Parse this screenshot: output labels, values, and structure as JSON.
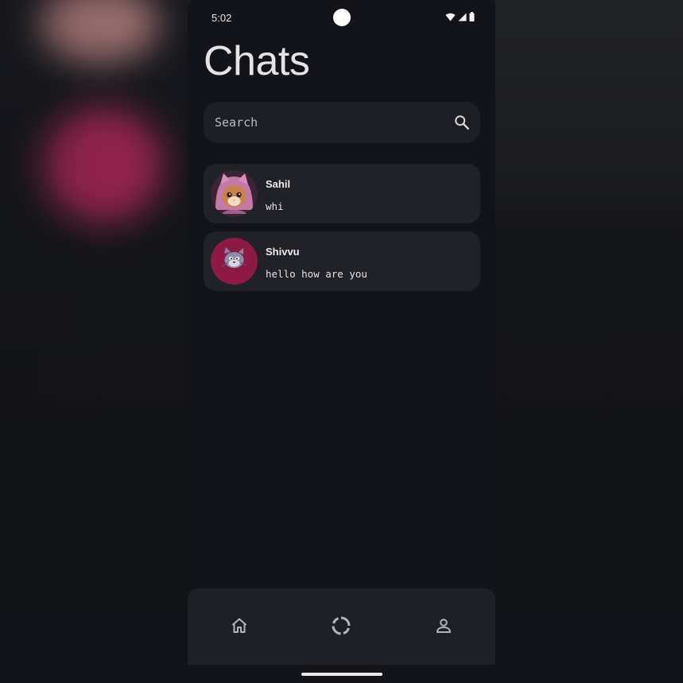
{
  "status_bar": {
    "time": "5:02",
    "icons": [
      "wifi-icon",
      "signal-icon",
      "battery-icon"
    ]
  },
  "header": {
    "title": "Chats"
  },
  "search": {
    "placeholder": "Search",
    "value": "",
    "icon": "search-icon"
  },
  "chats": [
    {
      "name": "Sahil",
      "message": "whi",
      "avatar": "cat-hoodie-avatar"
    },
    {
      "name": "Shivvu",
      "message": "hello how are you",
      "avatar": "cat-cartoon-avatar"
    }
  ],
  "bottom_nav": {
    "items": [
      {
        "icon": "home-icon"
      },
      {
        "icon": "status-ring-icon"
      },
      {
        "icon": "profile-icon"
      }
    ]
  },
  "colors": {
    "background": "#131419",
    "surface": "#212227",
    "search_bg": "#1e1f24",
    "nav_bg": "#1f2025",
    "text": "#e4e4e8",
    "avatar_accent": "#8c1a45"
  }
}
